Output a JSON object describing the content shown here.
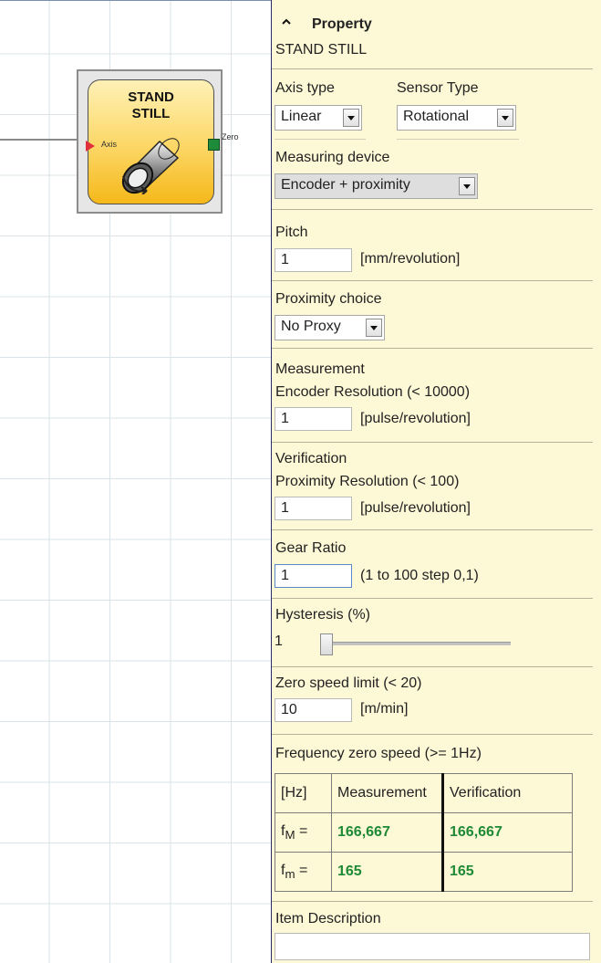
{
  "block": {
    "title": "STAND\nSTILL",
    "input_label": "Axis",
    "output_label": "Zero"
  },
  "panel": {
    "header": "Property",
    "block_name": "STAND STILL",
    "axis_type": {
      "label": "Axis type",
      "value": "Linear"
    },
    "sensor_type": {
      "label": "Sensor Type",
      "value": "Rotational"
    },
    "measuring_device": {
      "label": "Measuring device",
      "value": "Encoder + proximity"
    },
    "pitch": {
      "label": "Pitch",
      "value": "1",
      "unit": "[mm/revolution]"
    },
    "proximity_choice": {
      "label": "Proximity choice",
      "value": "No Proxy"
    },
    "measurement": {
      "title": "Measurement",
      "label": "Encoder Resolution  (< 10000)",
      "value": "1",
      "unit": "[pulse/revolution]"
    },
    "verification": {
      "title": "Verification",
      "label": "Proximity Resolution  (< 100)",
      "value": "1",
      "unit": "[pulse/revolution]"
    },
    "gear_ratio": {
      "label": "Gear Ratio",
      "value": "1",
      "hint": "(1 to 100 step 0,1)"
    },
    "hysteresis": {
      "label": "Hysteresis (%)",
      "value": "1"
    },
    "zero_speed": {
      "label": "Zero speed limit  (< 20)",
      "value": "10",
      "unit": "[m/min]"
    },
    "frequency": {
      "label": "Frequency zero speed (>= 1Hz)",
      "headers": [
        "[Hz]",
        "Measurement",
        "Verification"
      ],
      "rows": [
        {
          "name": "f",
          "sub": "M",
          "eq": " =",
          "measurement": "166,667",
          "verification": "166,667"
        },
        {
          "name": "f",
          "sub": "m",
          "eq": " =",
          "measurement": "165",
          "verification": "165"
        }
      ]
    },
    "item_description": {
      "label": "Item Description",
      "value": ""
    }
  },
  "colors": {
    "panel_bg": "#fdf8d6",
    "block_fill": "#fcd664",
    "value_green": "#1f8a36",
    "input_pin": "#e0303a",
    "output_pin": "#1d8b3a"
  }
}
